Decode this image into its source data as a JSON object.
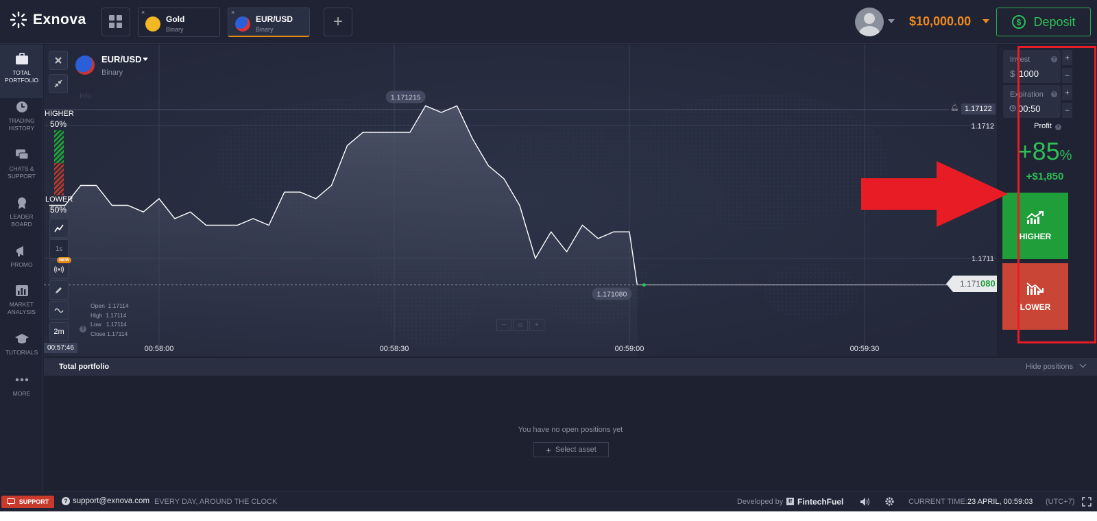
{
  "header": {
    "brand": "Exnova",
    "tabs": [
      {
        "name": "Gold",
        "type": "Binary",
        "close": "×"
      },
      {
        "name": "EUR/USD",
        "type": "Binary",
        "close": "×"
      }
    ],
    "add_tab": "+",
    "balance": "$10,000.00",
    "deposit_label": "Deposit"
  },
  "sidebar": {
    "items": [
      {
        "label1": "TOTAL",
        "label2": "PORTFOLIO",
        "icon": "briefcase-icon"
      },
      {
        "label1": "TRADING",
        "label2": "HISTORY",
        "icon": "clock-icon"
      },
      {
        "label1": "CHATS &",
        "label2": "SUPPORT",
        "icon": "chat-icon"
      },
      {
        "label1": "LEADER",
        "label2": "BOARD",
        "icon": "medal-icon"
      },
      {
        "label1": "PROMO",
        "label2": "",
        "icon": "megaphone-icon"
      },
      {
        "label1": "MARKET",
        "label2": "ANALYSIS",
        "icon": "bar-chart-icon"
      },
      {
        "label1": "TUTORIALS",
        "label2": "",
        "icon": "graduation-cap-icon"
      },
      {
        "label1": "MORE",
        "label2": "",
        "icon": "more-dots-icon"
      }
    ]
  },
  "chart": {
    "asset": "EUR/USD",
    "asset_type": "Binary",
    "higher_label": "HIGHER",
    "higher_pct": "50%",
    "lower_label": "LOWER",
    "lower_pct": "50%",
    "timeframe": "1s",
    "new_badge": "NEW",
    "period": "2m",
    "ohlc": {
      "open_label": "Open",
      "open": "1.17114",
      "high_label": "High",
      "high": "1.17114",
      "low_label": "Low",
      "low": "1.17114",
      "close_label": "Close",
      "close": "1.17114"
    },
    "info_label": "Info",
    "alert_price": "1.17122",
    "current_price_prefix": "1.171",
    "current_price_suffix": "080",
    "crosshair_time": "00:57:46",
    "peak_label": "1.171215",
    "last_label": "1.171080",
    "y_ticks": [
      "1.1712",
      "1.1711"
    ],
    "x_ticks": [
      "00:58:00",
      "00:58:30",
      "00:59:00",
      "00:59:30"
    ],
    "line_color": "#ffffff",
    "up_color": "#2fbf56"
  },
  "chart_data": {
    "type": "line",
    "title": "",
    "xlabel": "",
    "ylabel": "",
    "x": [
      "00:57:46",
      "00:57:48",
      "00:57:50",
      "00:57:52",
      "00:57:54",
      "00:57:56",
      "00:57:58",
      "00:58:00",
      "00:58:02",
      "00:58:04",
      "00:58:06",
      "00:58:08",
      "00:58:10",
      "00:58:12",
      "00:58:14",
      "00:58:16",
      "00:58:18",
      "00:58:20",
      "00:58:22",
      "00:58:24",
      "00:58:26",
      "00:58:28",
      "00:58:30",
      "00:58:32",
      "00:58:34",
      "00:58:36",
      "00:58:38",
      "00:58:40",
      "00:58:42",
      "00:58:44",
      "00:58:46",
      "00:58:48",
      "00:58:50",
      "00:58:52",
      "00:58:54",
      "00:58:56",
      "00:58:58",
      "00:59:00",
      "00:59:01"
    ],
    "values": [
      1.17114,
      1.17114,
      1.171155,
      1.171155,
      1.17114,
      1.17114,
      1.171135,
      1.171145,
      1.17113,
      1.171135,
      1.171125,
      1.171125,
      1.171125,
      1.17113,
      1.171125,
      1.17115,
      1.17115,
      1.171145,
      1.171155,
      1.171185,
      1.171195,
      1.171195,
      1.171195,
      1.171195,
      1.171215,
      1.17121,
      1.171215,
      1.17119,
      1.17117,
      1.17116,
      1.17114,
      1.1711,
      1.17112,
      1.171105,
      1.171125,
      1.171115,
      1.17112,
      1.17112,
      1.17108
    ],
    "ylim": [
      1.17107,
      1.171225
    ]
  },
  "trade": {
    "invest_label": "Invest",
    "currency": "$",
    "invest_value": "1000",
    "expiration_label": "Expiration",
    "expiration_value": "00:50",
    "profit_label": "Profit",
    "profit_pct_value": "+85",
    "profit_pct_sign": "%",
    "profit_amount": "+$1,850",
    "higher_button": "HIGHER",
    "lower_button": "LOWER",
    "higher_color": "#1f9e3a",
    "lower_color": "#c94636"
  },
  "portfolio": {
    "title": "Total portfolio",
    "hide_label": "Hide positions",
    "empty_text": "You have no open positions yet",
    "select_asset": "Select asset"
  },
  "status": {
    "support": "SUPPORT",
    "email": "support@exnova.com",
    "hours": "EVERY DAY, AROUND THE CLOCK",
    "developed_by": "Developed by",
    "dev_company": "FintechFuel",
    "current_time_label": "CURRENT TIME:",
    "current_time": "23 APRIL, 00:59:03",
    "timezone": "(UTC+7)"
  }
}
